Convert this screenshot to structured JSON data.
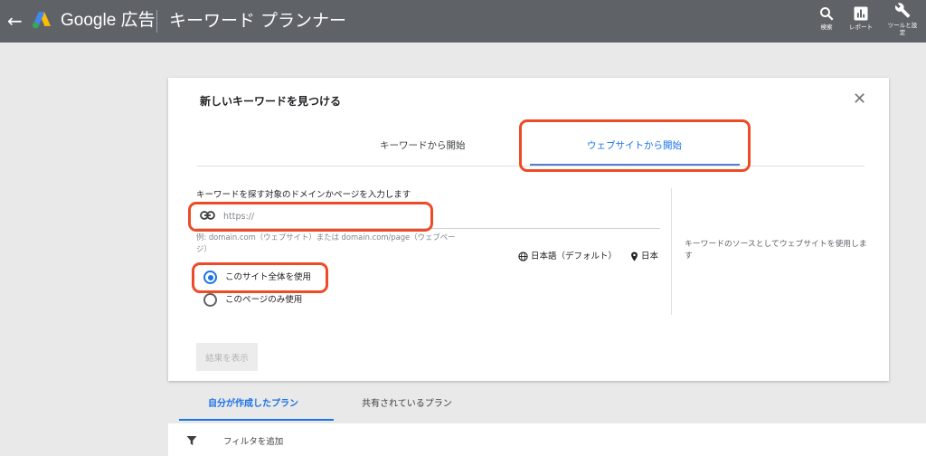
{
  "topbar": {
    "brand": "Google 広告",
    "title": "キーワード プランナー",
    "tools": [
      {
        "label": "検索",
        "icon": "search-icon"
      },
      {
        "label": "レポート",
        "icon": "report-icon"
      },
      {
        "label_line1": "ツールと設",
        "label_line2": "定",
        "icon": "wrench-icon"
      }
    ]
  },
  "card": {
    "title": "新しいキーワードを見つける",
    "close_icon": "close-icon",
    "tabs": [
      {
        "label": "キーワードから開始",
        "selected": false
      },
      {
        "label": "ウェブサイトから開始",
        "selected": true
      }
    ],
    "form": {
      "label": "キーワードを探す対象のドメインかページを入力します",
      "url_placeholder": "https://",
      "url_value": "",
      "hint": "例: domain.com（ウェブサイト）または domain.com/page（ウェブページ）",
      "language": "日本語（デフォルト）",
      "location": "日本",
      "radios": [
        {
          "label": "このサイト全体を使用",
          "checked": true
        },
        {
          "label": "このページのみ使用",
          "checked": false
        }
      ],
      "side_note": "キーワードのソースとしてウェブサイトを使用します",
      "submit_label": "結果を表示"
    }
  },
  "plan_tabs": [
    {
      "label": "自分が作成したプラン",
      "selected": true
    },
    {
      "label": "共有されているプラン",
      "selected": false
    }
  ],
  "filter": {
    "label": "フィルタを追加",
    "icon": "filter-icon"
  },
  "colors": {
    "topbar": "#5f6368",
    "accent": "#1a73e8",
    "highlight": "#ee4a26",
    "background": "#e9e9e9"
  }
}
